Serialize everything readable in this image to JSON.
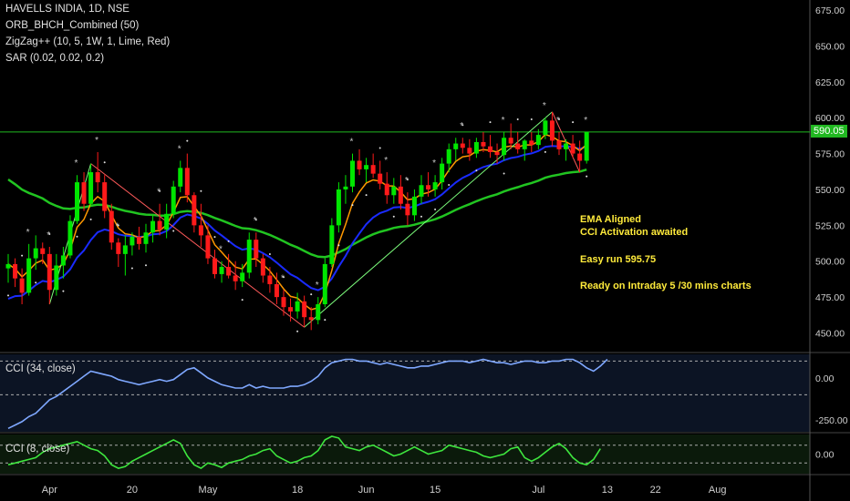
{
  "legend": {
    "symbol": "HAVELLS INDIA, 1D, NSE",
    "ind1": "ORB_BHCH_Combined (50)",
    "ind2": "ZigZag++ (10, 5, 1W, 1, Lime, Red)",
    "ind3": "SAR (0.02, 0.02, 0.2)",
    "cci34": "CCI (34, close)",
    "cci8": "CCI (8, close)"
  },
  "notes": {
    "line1": "EMA Aligned",
    "line2": "CCI Activation awaited",
    "line3": "Easy run 595.75",
    "line4": "Ready on Intraday 5 /30 mins charts"
  },
  "colors": {
    "up": "#00e600",
    "down": "#ff1a1a",
    "ema_fast": "#ff9800",
    "ema_mid": "#1a2bff",
    "ema_slow": "#21c421",
    "zigzag_up": "#7cfc7c",
    "zigzag_down": "#ff5a5a",
    "cci34": "#7fa8ff",
    "cci8": "#3ee63e",
    "level_line": "#21b821"
  },
  "chart_data": {
    "type": "candlestick",
    "title": "HAVELLS INDIA, 1D, NSE",
    "price_axis": {
      "ticks": [
        675,
        650,
        625,
        600,
        575,
        550,
        525,
        500,
        475,
        450
      ],
      "ylim": [
        437,
        682
      ]
    },
    "last_price_label": "590.05",
    "horizontal_level": 590.05,
    "x_tick_labels": [
      {
        "label": "Apr",
        "index": 6
      },
      {
        "label": "20",
        "index": 18
      },
      {
        "label": "May",
        "index": 29
      },
      {
        "label": "18",
        "index": 42
      },
      {
        "label": "Jun",
        "index": 52
      },
      {
        "label": "15",
        "index": 62
      },
      {
        "label": "Jul",
        "index": 77
      },
      {
        "label": "13",
        "index": 87
      },
      {
        "label": "22",
        "index": 94
      },
      {
        "label": "Aug",
        "index": 103
      }
    ],
    "candles": [
      [
        495,
        505,
        485,
        498
      ],
      [
        498,
        502,
        482,
        488
      ],
      [
        488,
        495,
        470,
        478
      ],
      [
        478,
        512,
        476,
        502
      ],
      [
        502,
        518,
        494,
        509
      ],
      [
        509,
        513,
        498,
        505
      ],
      [
        505,
        510,
        470,
        480
      ],
      [
        480,
        505,
        476,
        497
      ],
      [
        497,
        510,
        488,
        504
      ],
      [
        504,
        532,
        502,
        528
      ],
      [
        528,
        560,
        526,
        555
      ],
      [
        555,
        562,
        535,
        540
      ],
      [
        540,
        568,
        538,
        562
      ],
      [
        562,
        576,
        548,
        555
      ],
      [
        555,
        560,
        530,
        535
      ],
      [
        535,
        540,
        508,
        513
      ],
      [
        513,
        516,
        496,
        505
      ],
      [
        505,
        518,
        490,
        511
      ],
      [
        511,
        520,
        504,
        517
      ],
      [
        517,
        524,
        508,
        512
      ],
      [
        512,
        526,
        506,
        520
      ],
      [
        520,
        532,
        513,
        528
      ],
      [
        528,
        540,
        518,
        522
      ],
      [
        522,
        540,
        516,
        533
      ],
      [
        533,
        556,
        530,
        552
      ],
      [
        552,
        570,
        548,
        565
      ],
      [
        565,
        575,
        541,
        546
      ],
      [
        546,
        548,
        520,
        525
      ],
      [
        525,
        540,
        510,
        518
      ],
      [
        518,
        525,
        498,
        502
      ],
      [
        502,
        508,
        488,
        491
      ],
      [
        491,
        500,
        485,
        496
      ],
      [
        496,
        505,
        488,
        490
      ],
      [
        490,
        500,
        480,
        486
      ],
      [
        486,
        498,
        482,
        492
      ],
      [
        492,
        520,
        488,
        515
      ],
      [
        515,
        520,
        496,
        502
      ],
      [
        502,
        505,
        485,
        490
      ],
      [
        490,
        496,
        478,
        484
      ],
      [
        484,
        492,
        470,
        475
      ],
      [
        475,
        480,
        462,
        468
      ],
      [
        468,
        474,
        458,
        465
      ],
      [
        465,
        478,
        460,
        472
      ],
      [
        472,
        476,
        454,
        461
      ],
      [
        461,
        468,
        452,
        459
      ],
      [
        459,
        475,
        456,
        470
      ],
      [
        470,
        502,
        468,
        498
      ],
      [
        498,
        530,
        496,
        525
      ],
      [
        525,
        555,
        520,
        550
      ],
      [
        550,
        560,
        540,
        552
      ],
      [
        552,
        575,
        548,
        570
      ],
      [
        570,
        578,
        560,
        564
      ],
      [
        564,
        572,
        555,
        567
      ],
      [
        567,
        575,
        558,
        561
      ],
      [
        561,
        570,
        550,
        554
      ],
      [
        554,
        562,
        540,
        546
      ],
      [
        546,
        558,
        540,
        552
      ],
      [
        552,
        560,
        536,
        540
      ],
      [
        540,
        548,
        525,
        532
      ],
      [
        532,
        550,
        528,
        545
      ],
      [
        545,
        560,
        540,
        553
      ],
      [
        553,
        562,
        545,
        550
      ],
      [
        550,
        560,
        545,
        555
      ],
      [
        555,
        572,
        550,
        568
      ],
      [
        568,
        582,
        562,
        578
      ],
      [
        578,
        586,
        570,
        582
      ],
      [
        582,
        586,
        575,
        579
      ],
      [
        579,
        585,
        570,
        575
      ],
      [
        575,
        586,
        572,
        583
      ],
      [
        583,
        590,
        576,
        580
      ],
      [
        580,
        588,
        572,
        576
      ],
      [
        576,
        582,
        568,
        574
      ],
      [
        574,
        590,
        570,
        586
      ],
      [
        586,
        596,
        578,
        582
      ],
      [
        582,
        590,
        575,
        578
      ],
      [
        578,
        585,
        570,
        584
      ],
      [
        584,
        590,
        576,
        581
      ],
      [
        581,
        592,
        578,
        588
      ],
      [
        588,
        600,
        585,
        598
      ],
      [
        598,
        604,
        580,
        584
      ],
      [
        584,
        590,
        574,
        578
      ],
      [
        578,
        585,
        570,
        582
      ],
      [
        582,
        588,
        572,
        575
      ],
      [
        575,
        584,
        562,
        570
      ],
      [
        570,
        590,
        568,
        590
      ]
    ],
    "series": [
      {
        "name": "CCI (34, close)",
        "ticks": [
          0,
          -250
        ],
        "ylim": [
          -320,
          140
        ],
        "values": [
          -300,
          -280,
          -260,
          -230,
          -210,
          -170,
          -130,
          -110,
          -80,
          -50,
          -20,
          10,
          40,
          30,
          20,
          10,
          -10,
          -20,
          -30,
          -40,
          -30,
          -20,
          -10,
          -20,
          -10,
          20,
          50,
          60,
          30,
          0,
          -20,
          -40,
          -50,
          -60,
          -60,
          -40,
          -60,
          -50,
          -60,
          -60,
          -60,
          -50,
          -50,
          -40,
          -20,
          10,
          60,
          90,
          100,
          110,
          110,
          100,
          100,
          90,
          80,
          90,
          80,
          70,
          60,
          60,
          70,
          70,
          80,
          90,
          100,
          100,
          100,
          90,
          100,
          110,
          100,
          90,
          90,
          80,
          90,
          100,
          100,
          90,
          90,
          100,
          100,
          110,
          110,
          90,
          60,
          40,
          70,
          110
        ]
      },
      {
        "name": "CCI (8, close)",
        "ticks": [
          0
        ],
        "ylim": [
          -220,
          220
        ],
        "values": [
          -120,
          -100,
          -80,
          -60,
          -40,
          20,
          60,
          80,
          100,
          120,
          140,
          100,
          60,
          40,
          -20,
          -120,
          -160,
          -140,
          -80,
          -40,
          0,
          40,
          80,
          120,
          160,
          120,
          -20,
          -120,
          -160,
          -100,
          -120,
          -150,
          -100,
          -80,
          -60,
          -20,
          0,
          40,
          60,
          -20,
          -60,
          -100,
          -80,
          -40,
          -20,
          40,
          160,
          200,
          180,
          80,
          60,
          40,
          80,
          100,
          60,
          20,
          -20,
          0,
          40,
          80,
          40,
          0,
          20,
          40,
          100,
          80,
          60,
          40,
          20,
          -20,
          -40,
          -20,
          0,
          60,
          80,
          -40,
          -80,
          -40,
          20,
          80,
          120,
          60,
          -40,
          -100,
          -120,
          -60,
          60
        ]
      }
    ]
  }
}
